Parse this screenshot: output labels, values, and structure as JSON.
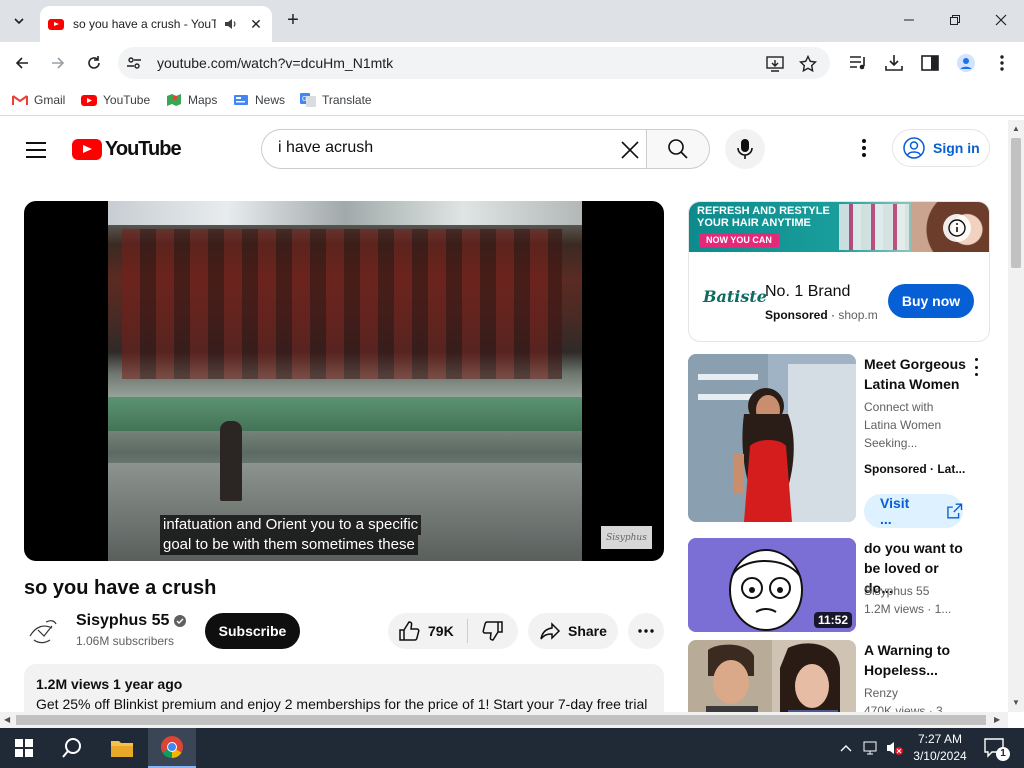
{
  "browser": {
    "tab_title": "so you have a crush - YouTube",
    "url": "youtube.com/watch?v=dcuHm_N1mtk",
    "new_tab_symbol": "+",
    "bookmarks": [
      {
        "label": "Gmail",
        "icon": "gmail-icon"
      },
      {
        "label": "YouTube",
        "icon": "youtube-icon"
      },
      {
        "label": "Maps",
        "icon": "maps-icon"
      },
      {
        "label": "News",
        "icon": "news-icon"
      },
      {
        "label": "Translate",
        "icon": "translate-icon"
      }
    ]
  },
  "header": {
    "logo_text": "YouTube",
    "search_value": "i have acrush",
    "signin_label": "Sign in"
  },
  "video": {
    "caption_line1": "infatuation and Orient you to a specific",
    "caption_line2": "goal to be with them sometimes these",
    "watermark": "Sisyphus",
    "title": "so you have a crush",
    "channel": "Sisyphus 55",
    "subscribers": "1.06M subscribers",
    "subscribe_label": "Subscribe",
    "likes": "79K",
    "share_label": "Share",
    "stats": "1.2M views  1 year ago",
    "description": "Get 25% off Blinkist premium and enjoy 2 memberships for the price of 1! Start your 7-day free trial"
  },
  "ad": {
    "banner_line1": "REFRESH AND RESTYLE YOUR HAIR ANYTIME",
    "banner_line2": "NOW YOU CAN",
    "logo": "Batiste",
    "title": "No. 1 Brand",
    "sponsored": "Sponsored",
    "domain": "shop.m",
    "cta": "Buy now"
  },
  "recommendations": [
    {
      "title": "Meet Gorgeous Latina Women",
      "desc": [
        "Connect with",
        "Latina Women",
        "Seeking..."
      ],
      "meta": "Sponsored · Lat...",
      "cta": "Visit ..."
    },
    {
      "title": "do you want to be loved or do...",
      "channel": "Sisyphus 55",
      "meta": "1.2M views · 1...",
      "duration": "11:52"
    },
    {
      "title": "A Warning to Hopeless...",
      "channel": "Renzy",
      "meta": "470K views · 3..."
    }
  ],
  "taskbar": {
    "time": "7:27 AM",
    "date": "3/10/2024",
    "notifications": "1"
  },
  "colors": {
    "youtube_red": "#ff0000",
    "link_blue": "#065fd4",
    "taskbar": "#1f2a36"
  }
}
